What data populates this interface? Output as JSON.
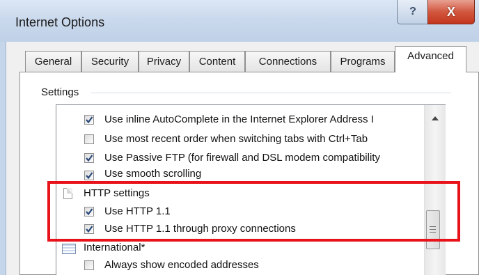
{
  "window": {
    "title": "Internet Options",
    "help_glyph": "?",
    "close_glyph": "X"
  },
  "tabs": [
    {
      "label": "General"
    },
    {
      "label": "Security"
    },
    {
      "label": "Privacy"
    },
    {
      "label": "Content"
    },
    {
      "label": "Connections"
    },
    {
      "label": "Programs"
    },
    {
      "label": "Advanced",
      "active": true
    }
  ],
  "settings": {
    "group_label": "Settings",
    "items": [
      {
        "type": "checkbox",
        "checked": true,
        "label": "Use inline AutoComplete in the Internet Explorer Address I"
      },
      {
        "type": "checkbox",
        "checked": false,
        "label": "Use most recent order when switching tabs with Ctrl+Tab"
      },
      {
        "type": "checkbox",
        "checked": true,
        "label": "Use Passive FTP (for firewall and DSL modem compatibility"
      },
      {
        "type": "checkbox",
        "checked": true,
        "label": "Use smooth scrolling"
      },
      {
        "type": "category",
        "icon": "document-icon",
        "label": "HTTP settings"
      },
      {
        "type": "checkbox",
        "checked": true,
        "label": "Use HTTP 1.1"
      },
      {
        "type": "checkbox",
        "checked": true,
        "label": "Use HTTP 1.1 through proxy connections"
      },
      {
        "type": "category",
        "icon": "international-icon",
        "label": "International*"
      },
      {
        "type": "checkbox",
        "checked": false,
        "label": "Always show encoded addresses"
      }
    ]
  },
  "colors": {
    "highlight": "#e8121a",
    "checkmark": "#2b4a7a"
  }
}
